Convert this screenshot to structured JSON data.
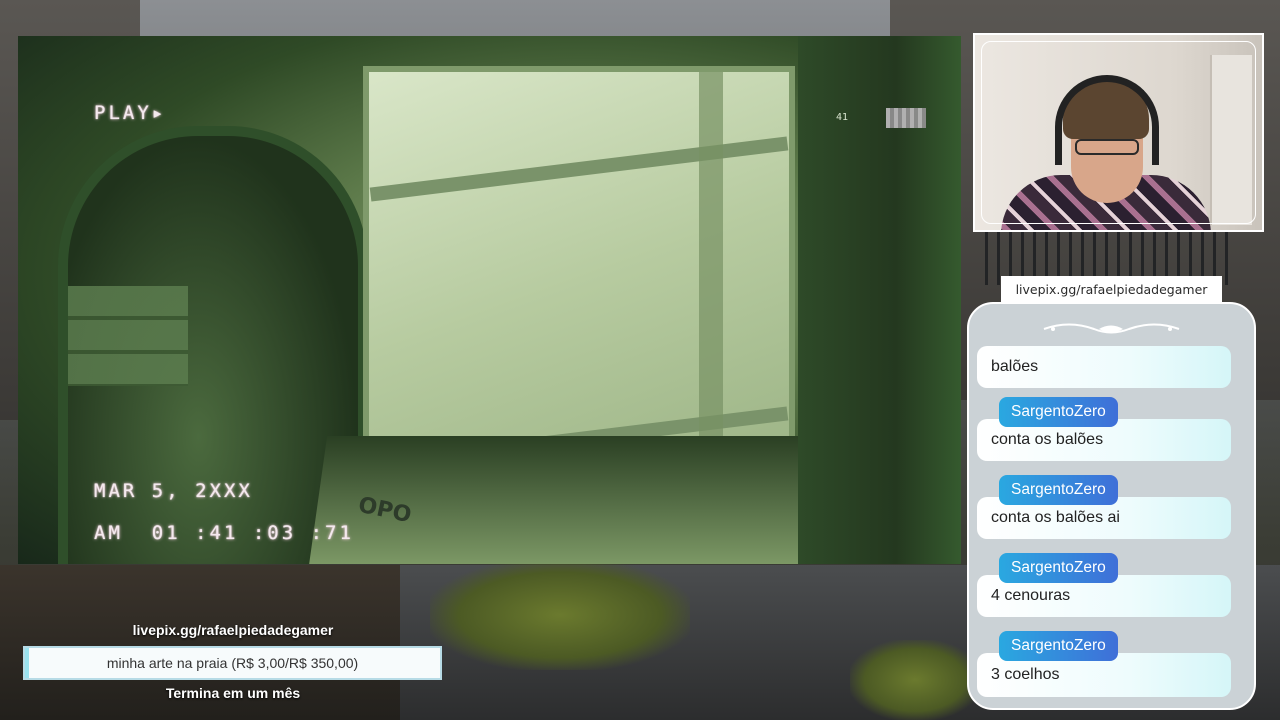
{
  "game": {
    "vhs_play": "PLAY▸",
    "vhs_date": "MAR 5, 2XXX",
    "vhs_time": "AM  01 :41 :03 :71",
    "counter": "41",
    "crate_stamp": "OPO"
  },
  "webcam": {},
  "livepix_tag": "livepix.gg/rafaelpiedadegamer",
  "chat": {
    "messages": [
      {
        "user": "",
        "text": "balões"
      },
      {
        "user": "SargentoZero",
        "text": "conta os balões"
      },
      {
        "user": "SargentoZero",
        "text": "conta os balões ai"
      },
      {
        "user": "SargentoZero",
        "text": "4 cenouras"
      },
      {
        "user": "SargentoZero",
        "text": "3 coelhos"
      }
    ]
  },
  "goal": {
    "url": "livepix.gg/rafaelpiedadegamer",
    "label": "minha arte na praia (R$ 3,00/R$ 350,00)",
    "progress_fraction": 0.0086,
    "subtitle": "Termina em um mês"
  },
  "colors": {
    "username_gradient_start": "#2aa8e0",
    "username_gradient_end": "#3f6fd8",
    "night_vision": "#5d7a4a"
  }
}
